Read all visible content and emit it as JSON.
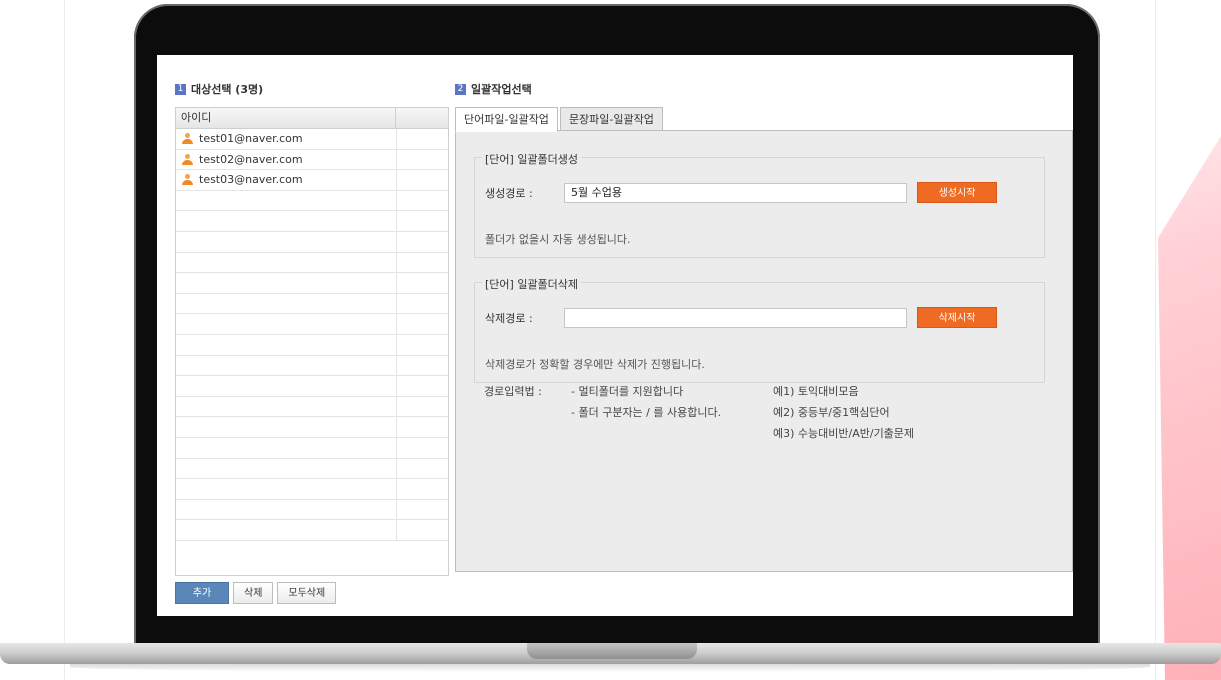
{
  "left": {
    "title": "대상선택 (3명)",
    "badge": "1",
    "column_header": "아이디",
    "users": [
      "test01@naver.com",
      "test02@naver.com",
      "test03@naver.com"
    ],
    "buttons": {
      "add": "추가",
      "delete": "삭제",
      "delete_all": "모두삭제"
    }
  },
  "right": {
    "title": "일괄작업선택",
    "badge": "2",
    "tabs": [
      "단어파일-일괄작업",
      "문장파일-일괄작업"
    ],
    "create": {
      "legend": "[단어] 일괄폴더생성",
      "label": "생성경로 :",
      "value": "5월 수업용",
      "button": "생성시작",
      "note": "폴더가 없을시 자동 생성됩니다."
    },
    "remove": {
      "legend": "[단어] 일괄폴더삭제",
      "label": "삭제경로 :",
      "value": "",
      "button": "삭제시작",
      "note": "삭제경로가 정확할 경우에만 삭제가 진행됩니다."
    },
    "guide": {
      "label": "경로입력법 :",
      "rules": [
        "- 멀티폴더를 지원합니다",
        "- 폴더 구분자는 / 를 사용합니다."
      ],
      "examples": [
        "예1) 토익대비모음",
        "예2) 중등부/중1핵심단어",
        "예3) 수능대비반/A반/기출문제"
      ]
    }
  },
  "colors": {
    "accent_orange": "#ef6a22",
    "primary_blue": "#5b87b8",
    "badge_blue": "#5a74c8"
  }
}
